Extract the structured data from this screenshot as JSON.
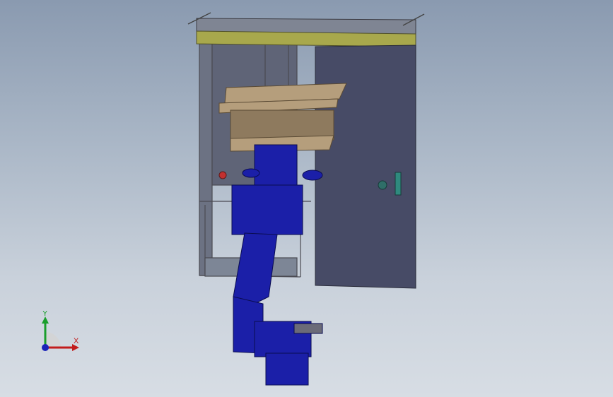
{
  "viewport": {
    "background_top": "#8a9ab0",
    "background_bottom": "#d7dde4"
  },
  "model": {
    "cabinet_color": "#474b66",
    "top_rail_color": "#a8a84c",
    "pallet_color": "#b59e7c",
    "robot_color": "#1b1fa8",
    "frame_color": "#52545e"
  },
  "triad": {
    "x_label": "X",
    "y_label": "Y",
    "x_color": "#c21c1c",
    "y_color": "#1a9e2c",
    "z_color": "#1a23b8"
  }
}
